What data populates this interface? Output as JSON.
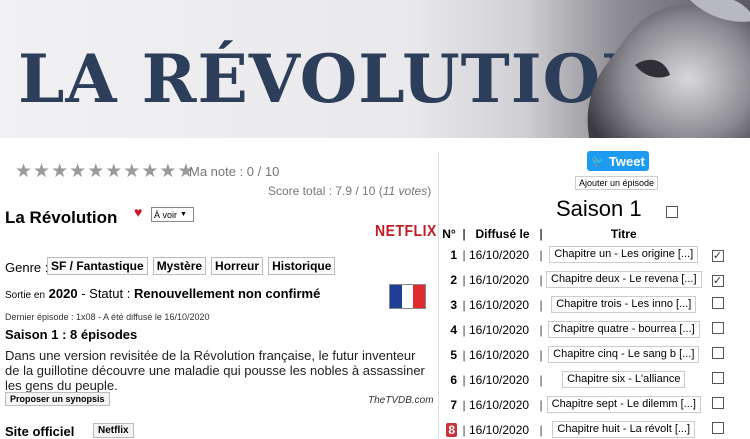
{
  "banner": {
    "title": "LA RÉVOLUTION"
  },
  "rating": {
    "stars_count": 10,
    "my_note": "Ma note : 0 / 10",
    "score_prefix": "Score total : 7.9 / 10 (",
    "score_votes": "11 votes",
    "score_suffix": ")"
  },
  "show": {
    "title": "La Révolution",
    "status_select": "À voir",
    "network_logo": "NETFLIX",
    "genre_label": "Genre :",
    "genres": [
      "SF / Fantastique",
      "Mystère",
      "Horreur",
      "Historique"
    ],
    "aired_prefix": "Sortie en",
    "year": "2020",
    "status_label": "- Statut :",
    "status_value": "Renouvellement non confirmé",
    "last_episode": "Dernier épisode : 1x08 - A été diffusé le 16/10/2020",
    "season_episodes": "Saison 1 : 8 épisodes",
    "synopsis": "Dans une version revisitée de la Révolution française, le futur inventeur de la guillotine découvre une maladie qui pousse les nobles à assassiner les gens du peuple.",
    "propose_synopsis": "Proposer un synopsis",
    "source": "TheTVDB.com",
    "official_site_label": "Site officiel",
    "official_site_sep": ":",
    "official_site_value": "Netflix"
  },
  "flag_colors": [
    "#1f3f97",
    "#ffffff",
    "#e12a2f"
  ],
  "sidebar": {
    "tweet_label": "Tweet",
    "add_episode": "Ajouter un épisode",
    "season_title": "Saison 1",
    "headers": {
      "num": "N°",
      "sep": "|",
      "date": "Diffusé le",
      "title": "Titre"
    },
    "episodes": [
      {
        "num": "1",
        "date": "16/10/2020",
        "title": "Chapitre un - Les origine [...]",
        "checked": true
      },
      {
        "num": "2",
        "date": "16/10/2020",
        "title": "Chapitre deux - Le revena [...]",
        "checked": true
      },
      {
        "num": "3",
        "date": "16/10/2020",
        "title": "Chapitre trois - Les inno [...]",
        "checked": false
      },
      {
        "num": "4",
        "date": "16/10/2020",
        "title": "Chapitre quatre - bourrea [...]",
        "checked": false
      },
      {
        "num": "5",
        "date": "16/10/2020",
        "title": "Chapitre cinq - Le sang b [...]",
        "checked": false
      },
      {
        "num": "6",
        "date": "16/10/2020",
        "title": "Chapitre six - L'alliance",
        "checked": false
      },
      {
        "num": "7",
        "date": "16/10/2020",
        "title": "Chapitre sept - Le dilemm [...]",
        "checked": false
      },
      {
        "num": "8",
        "date": "16/10/2020",
        "title": "Chapitre huit - La révolt [...]",
        "checked": false
      }
    ]
  }
}
